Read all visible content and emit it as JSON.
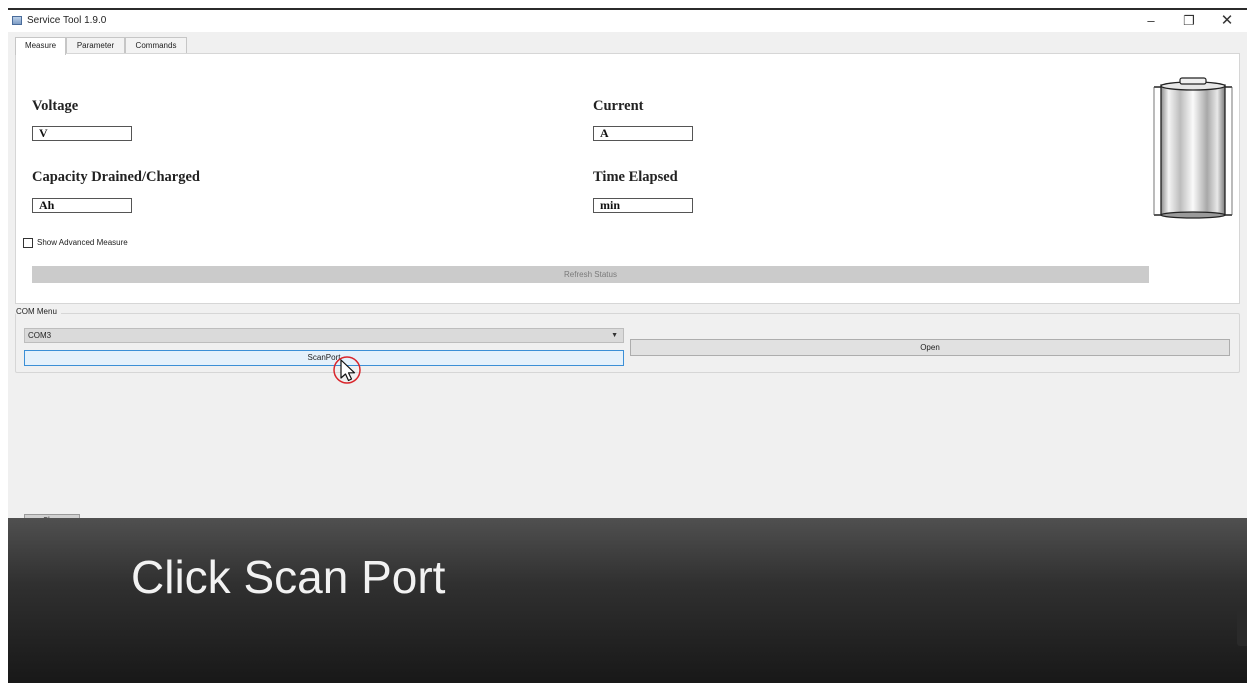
{
  "window": {
    "title": "Service Tool 1.9.0",
    "minimize_glyph": "–",
    "maximize_glyph": "❐",
    "close_glyph": "✕"
  },
  "tabs": [
    {
      "label": "Measure",
      "active": true
    },
    {
      "label": "Parameter",
      "active": false
    },
    {
      "label": "Commands",
      "active": false
    }
  ],
  "measure": {
    "voltage_label": "Voltage",
    "voltage_value": "V",
    "current_label": "Current",
    "current_value": "A",
    "capacity_label": "Capacity Drained/Charged",
    "capacity_value": "Ah",
    "time_label": "Time Elapsed",
    "time_value": "min",
    "advanced_label": "Show Advanced Measure",
    "advanced_checked": false,
    "refresh_label": "Refresh Status",
    "battery_icon": "battery-icon"
  },
  "com_menu": {
    "title": "COM Menu",
    "selected_port": "COM3",
    "dropdown_arrow": "▼",
    "scan_label": "ScanPort",
    "open_label": "Open"
  },
  "footer": {
    "close_label": "Close"
  },
  "caption": {
    "text": "Click Scan Port"
  },
  "colors": {
    "focus_border": "#3c8fd6",
    "focus_fill": "#e5f1fb",
    "cursor_ring": "#d9262c",
    "caption_bg": "#303030"
  }
}
